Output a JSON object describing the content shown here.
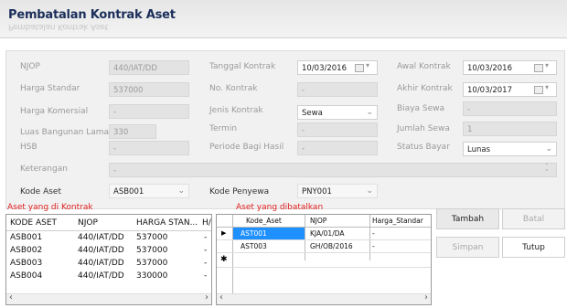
{
  "window": {
    "title": "Pembatalan Kontrak Aset",
    "title_shadow": "Pembatalan Kontrak Aset"
  },
  "form": {
    "njop": {
      "label": "NJOP",
      "value": "440/IAT/DD"
    },
    "harga_standar": {
      "label": "Harga Standar",
      "value": "537000"
    },
    "harga_komersial": {
      "label": "Harga Komersial",
      "value": "-"
    },
    "luas_bangunan_lama": {
      "label": "Luas Bangunan Lama",
      "value": "330"
    },
    "hsb": {
      "label": "HSB",
      "value": "-"
    },
    "keterangan": {
      "label": "Keterangan",
      "value": "-"
    },
    "kode_aset": {
      "label": "Kode Aset",
      "value": "ASB001"
    },
    "tanggal_kontrak": {
      "label": "Tanggal Kontrak",
      "value": "10/03/2016"
    },
    "no_kontrak": {
      "label": "No. Kontrak",
      "value": "-"
    },
    "jenis_kontrak": {
      "label": "Jenis Kontrak",
      "value": "Sewa"
    },
    "termin": {
      "label": "Termin",
      "value": "-"
    },
    "periode_bagi_hasil": {
      "label": "Periode Bagi Hasil",
      "value": "-"
    },
    "kode_penyewa": {
      "label": "Kode Penyewa",
      "value": "PNY001"
    },
    "awal_kontrak": {
      "label": "Awal Kontrak",
      "value": "10/03/2016"
    },
    "akhir_kontrak": {
      "label": "Akhir Kontrak",
      "value": "10/03/2017"
    },
    "biaya_sewa": {
      "label": "Biaya Sewa",
      "value": "-"
    },
    "jumlah_sewa": {
      "label": "Jumlah Sewa",
      "value": "1"
    },
    "status_bayar": {
      "label": "Status Bayar",
      "value": "Lunas"
    }
  },
  "left_grid": {
    "caption": "Aset yang di Kontrak",
    "headers": [
      "KODE ASET",
      "NJOP",
      "HARGA STAN...",
      "H/"
    ],
    "rows": [
      [
        "ASB001",
        "440/IAT/DD",
        "537000",
        "-"
      ],
      [
        "ASB002",
        "440/IAT/DD",
        "537000",
        "-"
      ],
      [
        "ASB003",
        "440/IAT/DD",
        "537000",
        "-"
      ],
      [
        "ASB004",
        "440/IAT/DD",
        "330000",
        "-"
      ]
    ]
  },
  "right_grid": {
    "caption": "Aset yang dibatalkan",
    "headers": [
      "Kode_Aset",
      "NJOP",
      "Harga_Standar"
    ],
    "rows": [
      [
        "AST001",
        "KJA/01/DA",
        "-"
      ],
      [
        "AST003",
        "GH/OB/2016",
        "-"
      ]
    ],
    "row_indicators": [
      "▶",
      "",
      "✱"
    ]
  },
  "buttons": {
    "tambah": "Tambah",
    "batal": "Batal",
    "simpan": "Simpan",
    "tutup": "Tutup"
  },
  "scroll": {
    "left": "‹",
    "right": "›"
  },
  "colors": {
    "caption_red": "#e02020",
    "selected_cell": "#1e90ff",
    "title_blue": "#1b2f5a"
  }
}
